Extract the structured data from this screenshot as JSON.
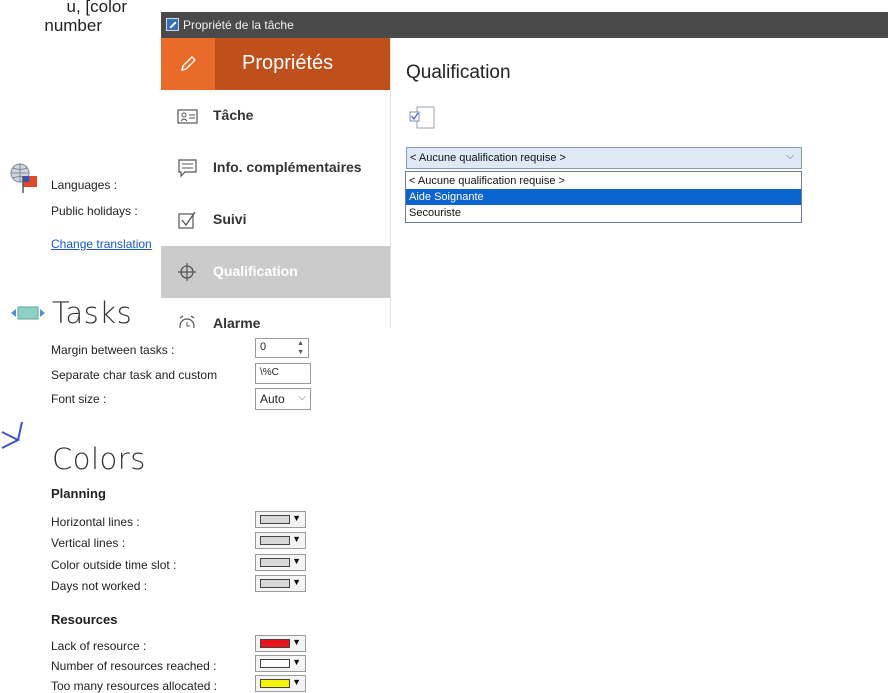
{
  "background": {
    "topleft_fragment": {
      "line1": "u, [color",
      "line2": "number"
    },
    "languages_label": "Languages :",
    "holidays_label": "Public holidays :",
    "change_translation_link": "Change translation",
    "tasks": {
      "title": "Tasks",
      "margin_label": "Margin between tasks :",
      "margin_value": "0",
      "separate_label": "Separate char task and custom",
      "separate_value": "\\%C",
      "fontsize_label": "Font size :",
      "fontsize_value": "Auto"
    },
    "colors": {
      "title": "Colors",
      "planning_title": "Planning",
      "planning_rows": [
        {
          "label": "Horizontal lines :",
          "color": "#d8d8d8"
        },
        {
          "label": "Vertical lines :",
          "color": "#d8d8d8"
        },
        {
          "label": "Color outside time slot :",
          "color": "#d8d8d8"
        },
        {
          "label": "Days not worked :",
          "color": "#d8d8d8"
        }
      ],
      "resources_title": "Resources",
      "resources_rows": [
        {
          "label": "Lack of resource :",
          "color": "#e8141b"
        },
        {
          "label": "Number of resources reached :",
          "color": "#ffffff"
        },
        {
          "label": "Too many resources allocated :",
          "color": "#f5f50a"
        }
      ]
    }
  },
  "dialog": {
    "window_title": "Propriété de la tâche",
    "sidebar": {
      "header_label": "Propriétés",
      "items": [
        {
          "label": "Tâche",
          "icon": "contact-card-icon",
          "active": false
        },
        {
          "label": "Info. complémentaires",
          "icon": "comment-icon",
          "active": false
        },
        {
          "label": "Suivi",
          "icon": "checkbox-icon",
          "active": false
        },
        {
          "label": "Qualification",
          "icon": "crosshair-icon",
          "active": true
        },
        {
          "label": "Alarme",
          "icon": "alarm-clock-icon",
          "active": false
        }
      ]
    },
    "main": {
      "title": "Qualification",
      "combo_value": "< Aucune qualification requise >",
      "options": [
        {
          "label": "< Aucune qualification requise >",
          "selected": false
        },
        {
          "label": "Aide Soignante",
          "selected": true
        },
        {
          "label": "Secouriste",
          "selected": false
        }
      ]
    }
  },
  "colors": {
    "sidebar_header": "#bf4f1b",
    "sidebar_header_icon_bg": "#ea6a2a",
    "active_nav_bg": "#cbcbcb",
    "selection": "#0a63cf",
    "title_bar": "#4a4a4a"
  }
}
